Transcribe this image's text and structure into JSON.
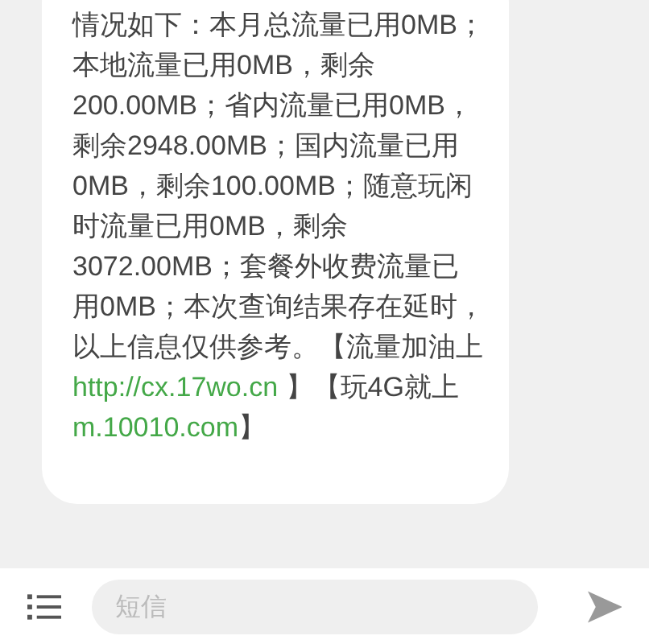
{
  "message": {
    "segments": [
      {
        "kind": "text",
        "text": "情况如下：本月总流量已用0MB；本地流量已用0MB，剩余200.00MB；省内流量已用0MB，剩余2948.00MB；国内流量已用0MB，剩余100.00MB；随意玩闲时流量已用0MB，剩余3072.00MB；套餐外收费流量已用0MB；本次查询结果存在延时，以上信息仅供参考。【流量加油上 "
      },
      {
        "kind": "link",
        "text": "http://cx.17wo.cn"
      },
      {
        "kind": "text",
        "text": " 】【玩4G就上 "
      },
      {
        "kind": "link",
        "text": "m.10010.com"
      },
      {
        "kind": "text",
        "text": "】"
      }
    ]
  },
  "composer": {
    "placeholder": "短信"
  }
}
